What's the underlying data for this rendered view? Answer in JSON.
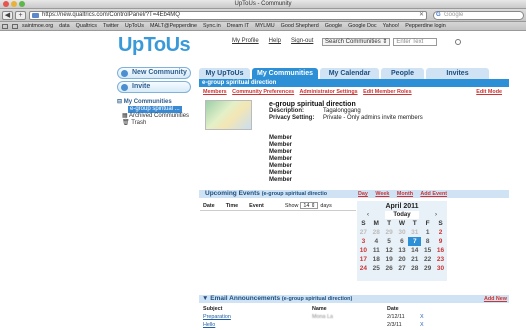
{
  "window": {
    "title": "UpToUs - Community"
  },
  "browser": {
    "url": "https://new.qualtrics.com/ControlPanel/?T=4Eb4MQ",
    "search_placeholder": "Google",
    "bookmarks": [
      "saintmoe.org",
      "data",
      "Qualtrics",
      "Twitter",
      "UpToUs",
      "MALT@Pepperdine",
      "Sync.in",
      "Dream IT",
      "MYLMU",
      "Good Shepherd",
      "Google",
      "Google Doc",
      "Yahoo!",
      "Pepperdine login"
    ]
  },
  "header": {
    "logo": "UpToUs",
    "links": {
      "profile": "My Profile",
      "help": "Help",
      "signout": "Sign-out"
    },
    "search": {
      "scope": "Search Communities",
      "placeholder": "Enter Text"
    }
  },
  "sidebar": {
    "new_community": "New Community",
    "invite": "Invite",
    "tree_root": "My Communities",
    "tree_selected": "e-group spiritual ...",
    "archived": "Archived Communities",
    "trash": "Trash"
  },
  "tabs": [
    "My UpToUs",
    "My Communities",
    "My Calendar",
    "People",
    "Invites"
  ],
  "community": {
    "band_title": "e-group spiritual direction",
    "subnav": [
      "Members",
      "Community Preferences",
      "Administrator Settings",
      "Edit Member Roles"
    ],
    "edit_mode": "Edit Mode",
    "title": "e-group spiritual direction",
    "description_label": "Description:",
    "description_value": "Tagalonggang",
    "privacy_label": "Privacy Setting:",
    "privacy_value": "Private - Only admins invite members",
    "member_label": "Member",
    "member_count": 7
  },
  "events": {
    "title": "Upcoming Events",
    "subtitle": "(e-group spiritual directio",
    "views": [
      "Day",
      "Week",
      "Month",
      "Add Event"
    ],
    "col_date": "Date",
    "col_time": "Time",
    "col_event": "Event",
    "show_label": "Show",
    "show_value": "14",
    "days_label": "days"
  },
  "calendar": {
    "month": "April 2011",
    "today": "Today",
    "prev": "‹",
    "next": "›",
    "weekdays": [
      "S",
      "M",
      "T",
      "W",
      "T",
      "F",
      "S"
    ],
    "weeks": [
      [
        "27",
        "28",
        "29",
        "30",
        "31",
        "1",
        "2"
      ],
      [
        "3",
        "4",
        "5",
        "6",
        "7",
        "8",
        "9"
      ],
      [
        "10",
        "11",
        "12",
        "13",
        "14",
        "15",
        "16"
      ],
      [
        "17",
        "18",
        "19",
        "20",
        "21",
        "22",
        "23"
      ],
      [
        "24",
        "25",
        "26",
        "27",
        "28",
        "29",
        "30"
      ]
    ],
    "current_day": "7"
  },
  "email": {
    "title": "Email Announcements",
    "subtitle": "(e-group spiritual direction)",
    "add_new": "Add New",
    "col_subject": "Subject",
    "col_name": "Name",
    "col_date": "Date",
    "rows": [
      {
        "subject": "Preparation",
        "name": "Mona La",
        "date": "2/12/11",
        "action": "X"
      },
      {
        "subject": "Hello",
        "name": "",
        "date": "2/3/11",
        "action": "X"
      }
    ]
  },
  "colors": {
    "accent": "#2d8fd5",
    "link_red": "#cc3333",
    "tab_light": "#cfe3f4"
  }
}
